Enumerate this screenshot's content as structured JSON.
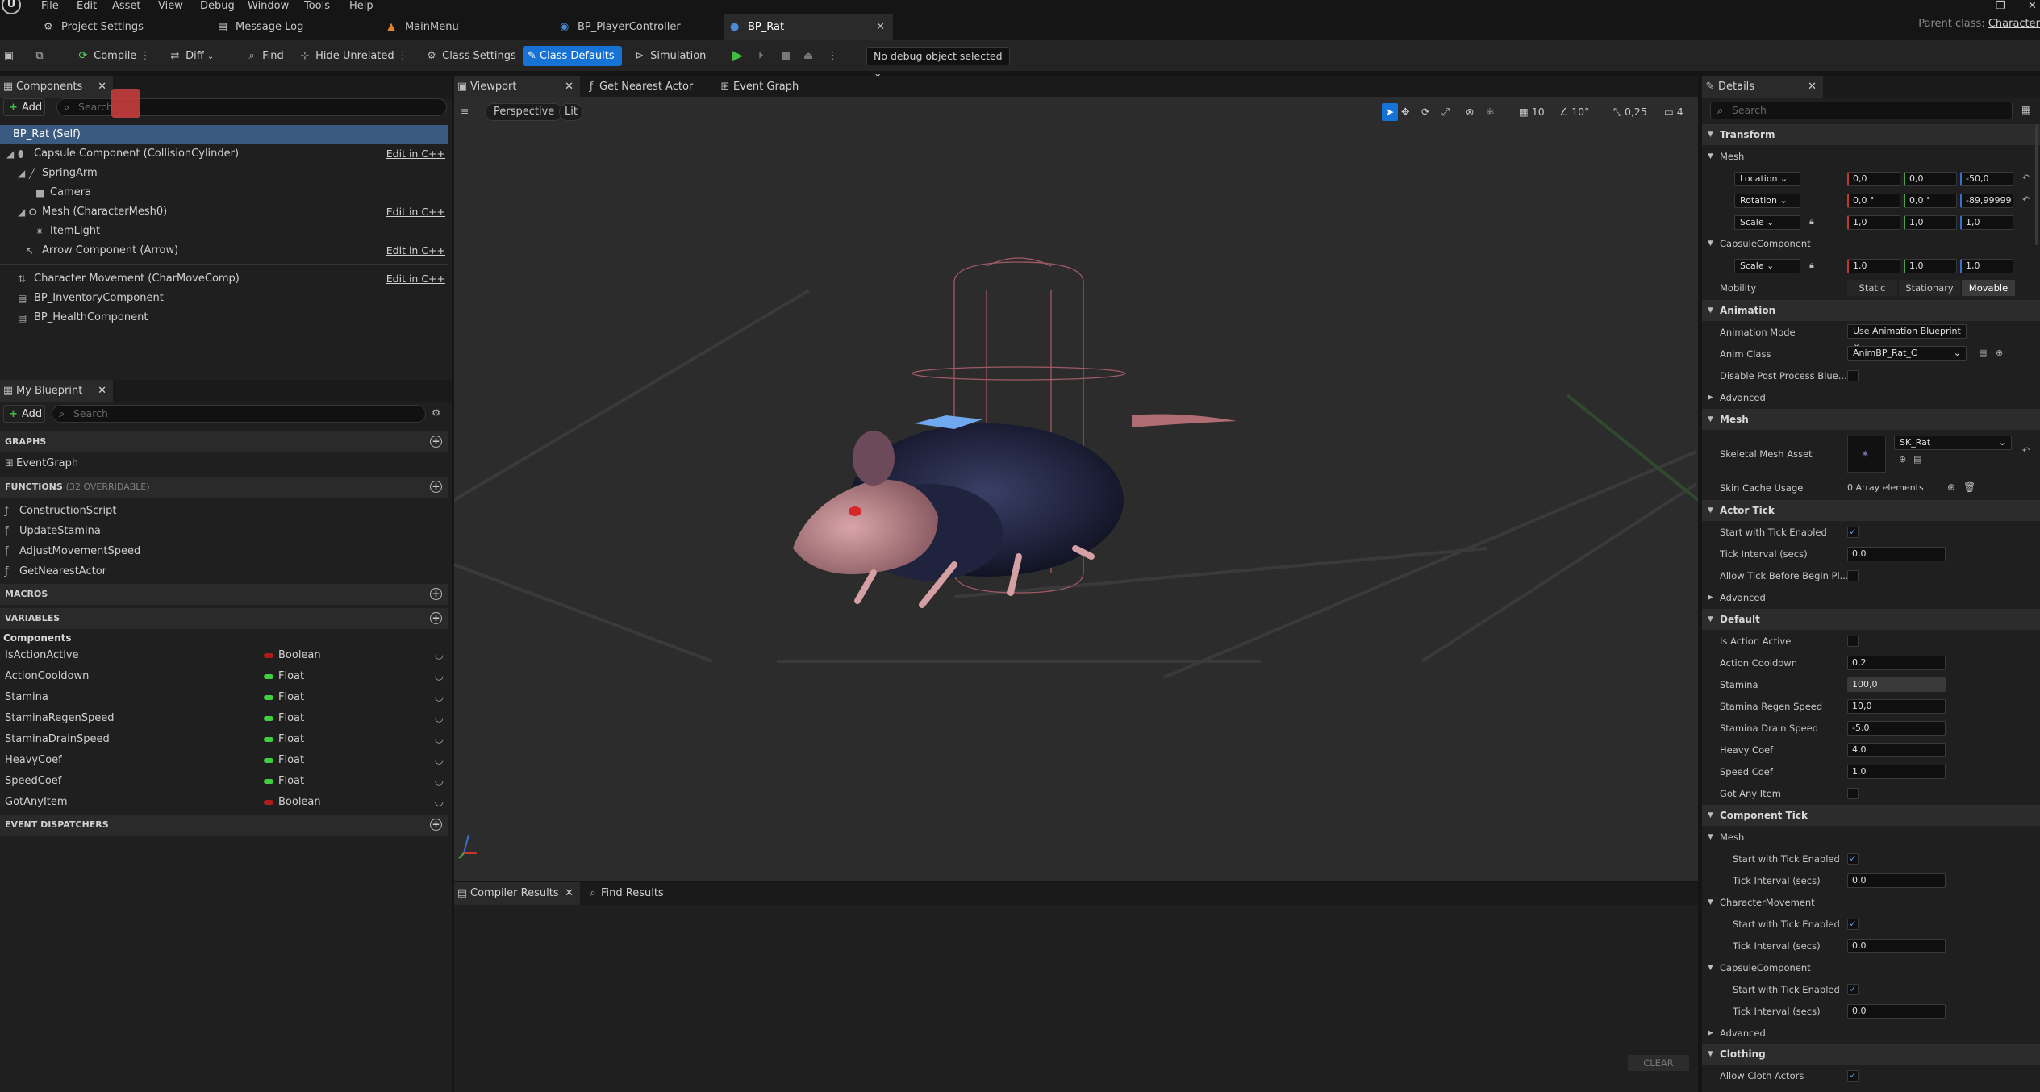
{
  "menu": {
    "items": [
      "File",
      "Edit",
      "Asset",
      "View",
      "Debug",
      "Window",
      "Tools",
      "Help"
    ]
  },
  "tabs": [
    {
      "label": "Project Settings"
    },
    {
      "label": "Message Log"
    },
    {
      "label": "MainMenu"
    },
    {
      "label": "BP_PlayerController"
    },
    {
      "label": "BP_Rat"
    }
  ],
  "parent_class": {
    "label": "Parent class:",
    "value": "Character"
  },
  "toolbar": {
    "compile": "Compile",
    "diff": "Diff",
    "find": "Find",
    "hide_unrelated": "Hide Unrelated",
    "class_settings": "Class Settings",
    "class_defaults": "Class Defaults",
    "simulation": "Simulation",
    "debug_object": "No debug object selected"
  },
  "components_panel": {
    "title": "Components",
    "add": "Add",
    "search_placeholder": "Search",
    "items": [
      {
        "label": "BP_Rat (Self)"
      },
      {
        "label": "Capsule Component (CollisionCylinder)",
        "edit": "Edit in C++"
      },
      {
        "label": "SpringArm"
      },
      {
        "label": "Camera"
      },
      {
        "label": "Mesh (CharacterMesh0)",
        "edit": "Edit in C++"
      },
      {
        "label": "ItemLight"
      },
      {
        "label": "Arrow Component (Arrow)",
        "edit": "Edit in C++"
      },
      {
        "label": "Character Movement (CharMoveComp)",
        "edit": "Edit in C++"
      },
      {
        "label": "BP_InventoryComponent"
      },
      {
        "label": "BP_HealthComponent"
      }
    ]
  },
  "my_blueprint": {
    "title": "My Blueprint",
    "add": "Add",
    "search_placeholder": "Search",
    "graphs_label": "GRAPHS",
    "graphs": [
      "EventGraph"
    ],
    "functions_label": "FUNCTIONS",
    "functions_sub": "(32 OVERRIDABLE)",
    "functions": [
      "ConstructionScript",
      "UpdateStamina",
      "AdjustMovementSpeed",
      "GetNearestActor"
    ],
    "macros_label": "MACROS",
    "variables_label": "VARIABLES",
    "components_label": "Components",
    "variables": [
      {
        "name": "IsActionActive",
        "type": "Boolean",
        "color": "#b01c1c"
      },
      {
        "name": "ActionCooldown",
        "type": "Float",
        "color": "#3fcf3f"
      },
      {
        "name": "Stamina",
        "type": "Float",
        "color": "#3fcf3f"
      },
      {
        "name": "StaminaRegenSpeed",
        "type": "Float",
        "color": "#3fcf3f"
      },
      {
        "name": "StaminaDrainSpeed",
        "type": "Float",
        "color": "#3fcf3f"
      },
      {
        "name": "HeavyCoef",
        "type": "Float",
        "color": "#3fcf3f"
      },
      {
        "name": "SpeedCoef",
        "type": "Float",
        "color": "#3fcf3f"
      },
      {
        "name": "GotAnyItem",
        "type": "Boolean",
        "color": "#b01c1c"
      }
    ],
    "dispatchers_label": "EVENT DISPATCHERS"
  },
  "editor_tabs": {
    "viewport": "Viewport",
    "get_nearest": "Get Nearest Actor",
    "event_graph": "Event Graph"
  },
  "viewport": {
    "perspective": "Perspective",
    "lit": "Lit",
    "grid": "10",
    "angle": "10°",
    "scale": "0,25",
    "cam": "4"
  },
  "bottom": {
    "compiler": "Compiler Results",
    "find": "Find Results",
    "clear": "CLEAR"
  },
  "details": {
    "title": "Details",
    "search_placeholder": "Search",
    "transform": "Transform",
    "mesh_sub": "Mesh",
    "location_label": "Location",
    "location": [
      "0,0",
      "0,0",
      "-50,0"
    ],
    "rotation_label": "Rotation",
    "rotation": [
      "0,0 °",
      "0,0 °",
      "-89,99999"
    ],
    "scale_label": "Scale",
    "scale": [
      "1,0",
      "1,0",
      "1,0"
    ],
    "capsule_sub": "CapsuleComponent",
    "cap_scale": [
      "1,0",
      "1,0",
      "1,0"
    ],
    "mobility": "Mobility",
    "mobility_opts": [
      "Static",
      "Stationary",
      "Movable"
    ],
    "animation": "Animation",
    "anim_mode_label": "Animation Mode",
    "anim_mode": "Use Animation Blueprint",
    "anim_class_label": "Anim Class",
    "anim_class": "AnimBP_Rat_C",
    "disable_pp": "Disable Post Process Blue...",
    "advanced": "Advanced",
    "mesh": "Mesh",
    "skeletal_label": "Skeletal Mesh Asset",
    "skeletal": "SK_Rat",
    "skin_cache": "Skin Cache Usage",
    "skin_cache_val": "0 Array elements",
    "actor_tick": "Actor Tick",
    "start_tick": "Start with Tick Enabled",
    "tick_interval": "Tick Interval (secs)",
    "tick_val": "0,0",
    "allow_tick": "Allow Tick Before Begin Pl...",
    "default": "Default",
    "is_action": "Is Action Active",
    "action_cd": "Action Cooldown",
    "action_cd_val": "0,2",
    "stamina": "Stamina",
    "stamina_val": "100,0",
    "regen": "Stamina Regen Speed",
    "regen_val": "10,0",
    "drain": "Stamina Drain Speed",
    "drain_val": "-5,0",
    "heavy": "Heavy Coef",
    "heavy_val": "4,0",
    "speed": "Speed Coef",
    "speed_val": "1,0",
    "got_item": "Got Any Item",
    "component_tick": "Component Tick",
    "ct_mesh": "Mesh",
    "ct_charmove": "CharacterMovement",
    "ct_capsule": "CapsuleComponent",
    "clothing": "Clothing",
    "allow_cloth": "Allow Cloth Actors"
  }
}
